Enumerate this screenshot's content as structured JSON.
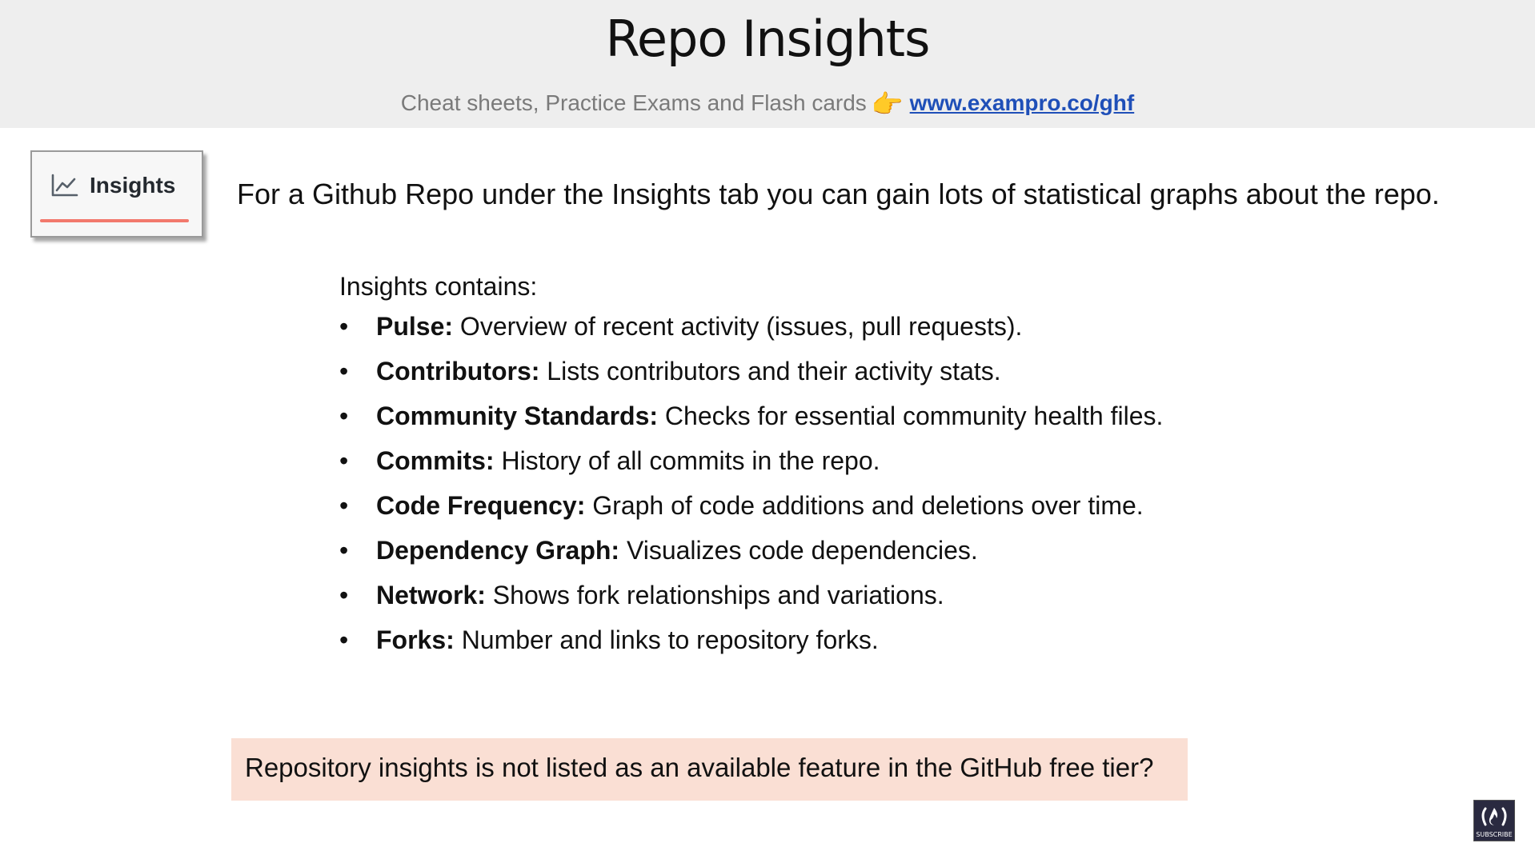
{
  "header": {
    "title": "Repo Insights",
    "subtitle_text": "Cheat sheets, Practice Exams and Flash cards",
    "subtitle_icon": "pointing-hand-icon",
    "subtitle_link": "www.exampro.co/ghf"
  },
  "tab": {
    "icon": "graph-icon",
    "label": "Insights",
    "underline_color": "#f2796d"
  },
  "lead": "For a Github Repo under the Insights tab you can gain lots of statistical graphs about  the repo.",
  "list": {
    "heading": "Insights contains:",
    "bullet": "•",
    "items": [
      {
        "term": "Pulse:",
        "desc": " Overview of recent activity (issues, pull requests)."
      },
      {
        "term": "Contributors:",
        "desc": " Lists contributors and their activity stats."
      },
      {
        "term": "Community Standards:",
        "desc": " Checks for essential community health files."
      },
      {
        "term": "Commits:",
        "desc": " History of all commits in the repo."
      },
      {
        "term": "Code Frequency:",
        "desc": " Graph of code additions and deletions over time."
      },
      {
        "term": "Dependency Graph:",
        "desc": " Visualizes code dependencies."
      },
      {
        "term": "Network:",
        "desc": " Shows fork relationships and variations."
      },
      {
        "term": "Forks:",
        "desc": " Number and links to repository forks."
      }
    ]
  },
  "note": {
    "text": "Repository insights is not listed as an available feature in the GitHub free tier?",
    "background": "#fadfd4"
  },
  "logo": {
    "icon": "freecodecamp-logo-icon",
    "caption": "SUBSCRIBE"
  }
}
